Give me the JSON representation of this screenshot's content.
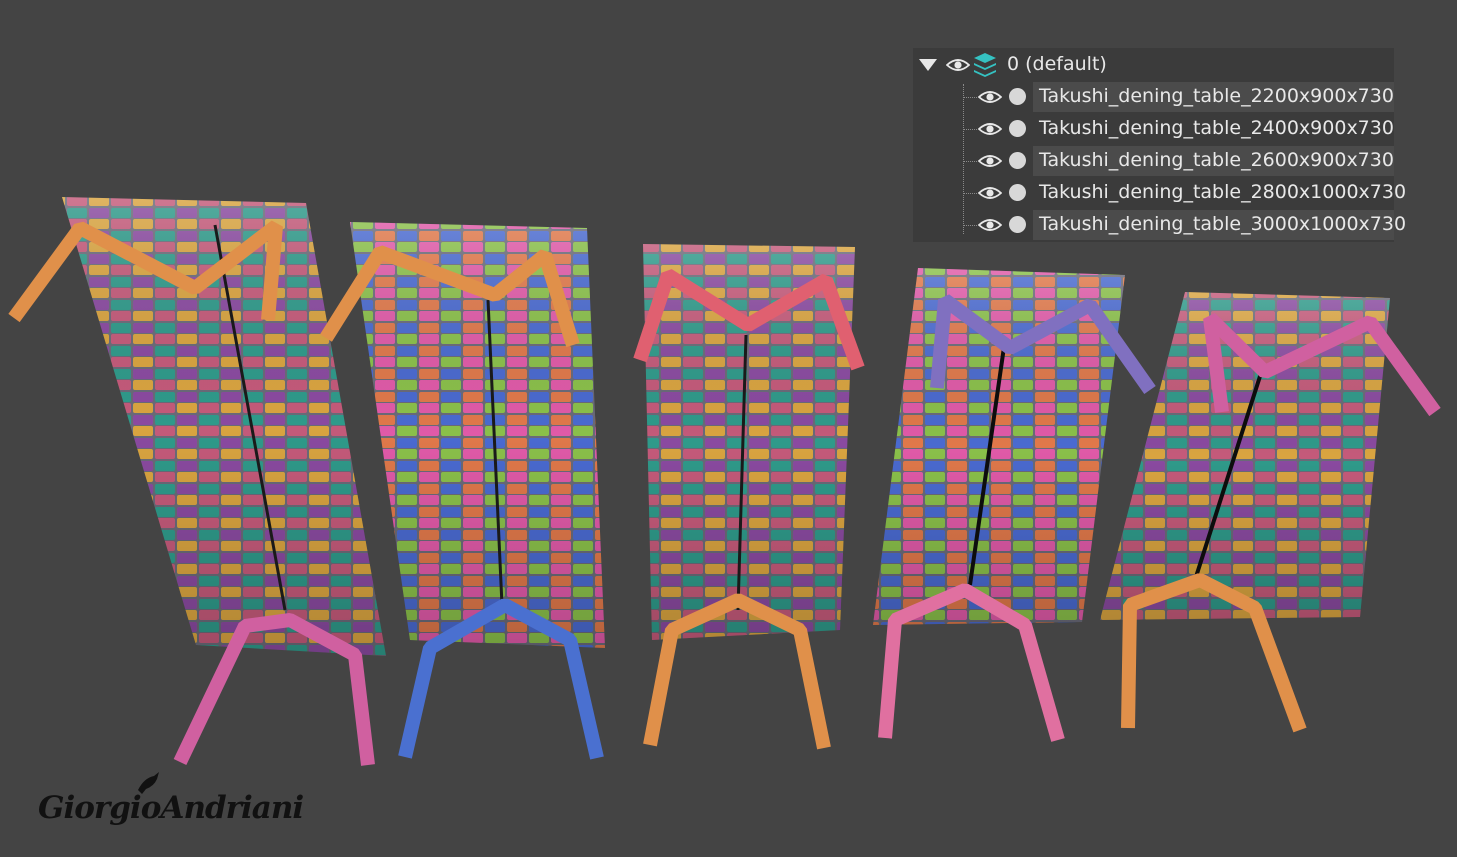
{
  "layer_explorer": {
    "root_layer": "0 (default)",
    "layers": [
      "Takushi_dening_table_2200x900x730",
      "Takushi_dening_table_2400x900x730",
      "Takushi_dening_table_2600x900x730",
      "Takushi_dening_table_2800x1000x730",
      "Takushi_dening_table_3000x1000x730"
    ]
  },
  "signature": "GiorgioAndriani",
  "colors": {
    "background": "#444444",
    "panel": "#3b3b3b",
    "panel_row": "#4b4b4b",
    "panel_text": "#e8e8e8",
    "layer_icon": "#35c2c2"
  },
  "icons": [
    "expand-triangle-icon",
    "eye-icon",
    "layers-stack-icon",
    "layer-dot-icon",
    "bird-icon"
  ]
}
